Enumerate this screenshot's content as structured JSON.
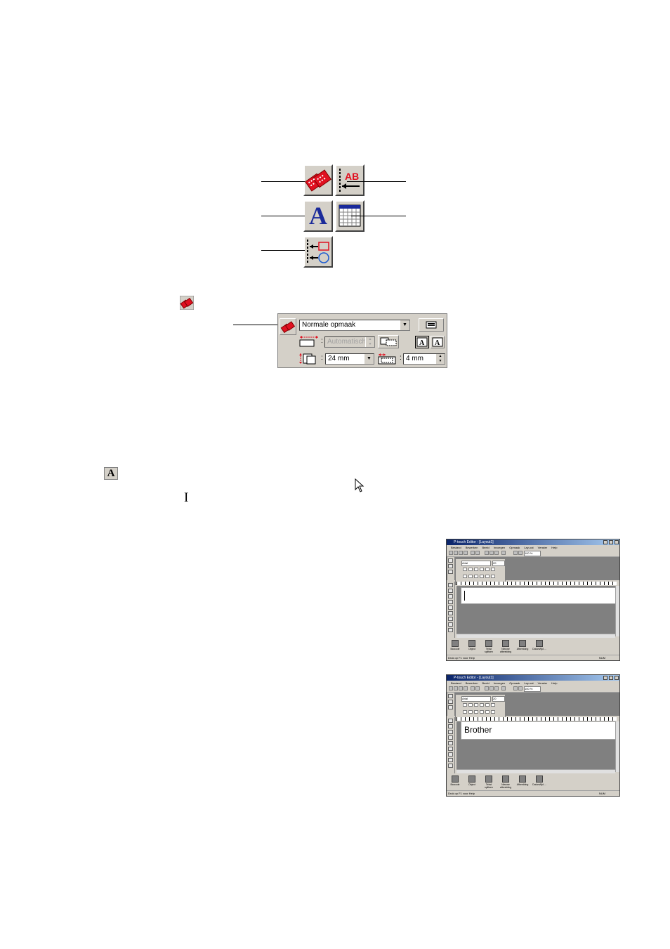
{
  "toolbar_icons": [
    {
      "name": "layout-properties",
      "icon": "layout-properties-icon"
    },
    {
      "name": "text-properties",
      "icon": "text-properties-icon"
    },
    {
      "name": "text-tool",
      "icon": "text-tool-icon",
      "label": "A"
    },
    {
      "name": "table-properties",
      "icon": "table-properties-icon"
    },
    {
      "name": "object-layout",
      "icon": "object-layout-icon"
    }
  ],
  "text_properties_icon_label": "AB",
  "text_tool_label": "A",
  "inline_text_icon_label": "A",
  "cursor_ibeam_glyph": "I",
  "layout_panel": {
    "format_select": "Normale opmaak",
    "length_value": "Automatisch",
    "width_select": "24 mm",
    "margin_value": "4 mm"
  },
  "mini_window_1": {
    "title": "P-touch Editor - [Layout1]",
    "menu": [
      "Bestand",
      "Bewerken",
      "Beeld",
      "Invoegen",
      "Opmaak",
      "Lay-out",
      "Venster",
      "Help"
    ],
    "font_name": "Arial",
    "font_size": "20",
    "zoom": "100 %",
    "bottom_buttons": [
      "Barcode",
      "Object",
      "Tekst splitsen",
      "Nieuwe afbeelding",
      "Afbeelding",
      "Datum/tijd ..."
    ],
    "status": "Druk op F1 voor Help",
    "status_right": "NUM",
    "paper_text": ""
  },
  "mini_window_2": {
    "title": "P-touch Editor - [Layout1]",
    "menu": [
      "Bestand",
      "Bewerken",
      "Beeld",
      "Invoegen",
      "Opmaak",
      "Lay-out",
      "Venster",
      "Help"
    ],
    "font_name": "Arial",
    "font_size": "20",
    "zoom": "100 %",
    "bottom_buttons": [
      "Barcode",
      "Object",
      "Tekst splitsen",
      "Nieuwe afbeelding",
      "Afbeelding",
      "Datum/tijd ..."
    ],
    "status": "Druk op F1 voor Help",
    "status_right": "NUM",
    "paper_text": "Brother"
  },
  "colors": {
    "accent_red": "#e01020",
    "text_blue": "#1a2a9a",
    "button_face": "#d4d0c8"
  }
}
